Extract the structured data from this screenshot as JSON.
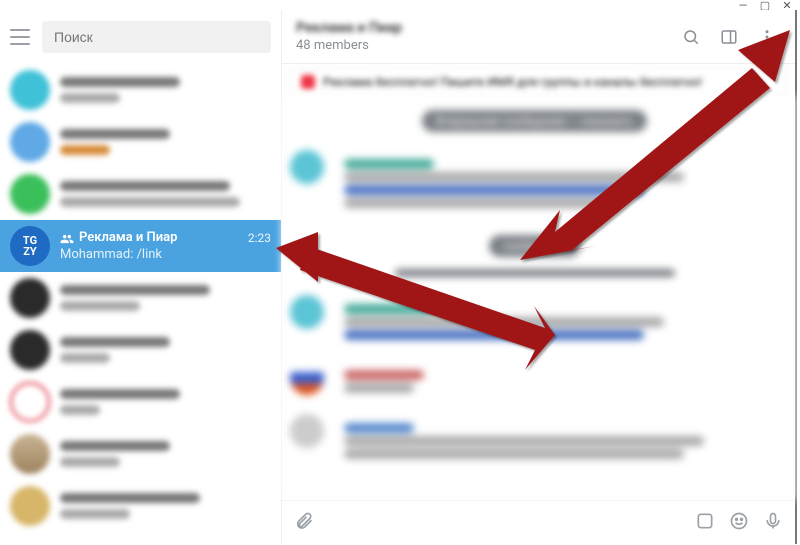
{
  "window": {
    "min": "—",
    "max": "▢",
    "close": "✕"
  },
  "search": {
    "placeholder": "Поиск"
  },
  "selected_chat": {
    "avatar_text": "TG\nZY",
    "title": "Реклама и Пиар",
    "time": "2:23",
    "preview": "Mohammad: /link"
  },
  "header": {
    "title": "Реклама и Пиар",
    "members": "48 members"
  },
  "pinned": {
    "text": "Реклама бесплатно! Пишите ИМЯ для группы и каналы бесплатно!"
  },
  "composer": {
    "placeholder": " "
  },
  "blur_chats": [
    {
      "color": "#3fc1d8"
    },
    {
      "color": "#5fa9e6"
    },
    {
      "color": "#3bbf5b"
    },
    {
      "color": "#2a2a2a"
    },
    {
      "color": "#2a2a2a"
    },
    {
      "color": "#d23"
    },
    {
      "color": "#cfa"
    },
    {
      "color": "#d7b66a"
    }
  ]
}
